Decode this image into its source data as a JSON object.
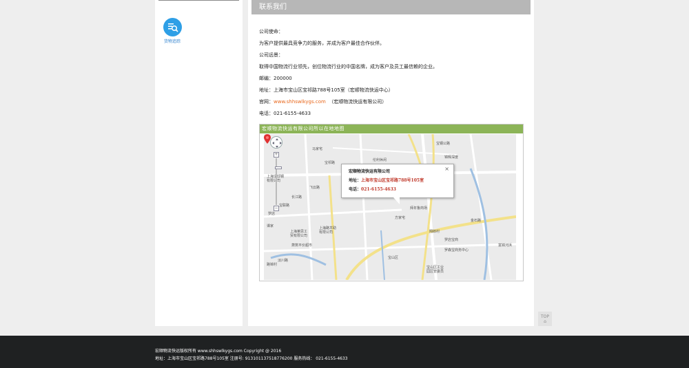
{
  "sidebar": {
    "track_label": "货物追踪",
    "track_icon": "search-list-icon"
  },
  "contact": {
    "header": "联系我们",
    "mission_label": "公司使命：",
    "mission_text": "为客户提供最具竞争力的服务，并成为客户最佳合作伙伴。",
    "vision_label": "公司远景：",
    "vision_text": "取得中国物流行业领先，创位物流行业的中国名牌，成为客户及员工最信赖的企业。",
    "postcode": "邮编：200000",
    "address": "地址：上海市宝山区宝祁路788号105室（宏顺物流快运中心）",
    "website_label": "官网：",
    "website_url": "www.shhswlkygs.com",
    "website_note": "（宏顺物流快运有限公司）",
    "phone": "电话：021-6155-4633"
  },
  "map": {
    "title": "宏顺物流快运有限公司所以在地地图",
    "popup_title": "宏顺物流快运有限公司",
    "popup_address_label": "地址：",
    "popup_address": "上海市宝山区宝祁路788号105室",
    "popup_phone_label": "电话：",
    "popup_phone": "021-6155-4633",
    "labels": [
      "马家宅",
      "宝祁路",
      "宏顺物流快运",
      "伦利休闲",
      "宝钢公路",
      "锦辉深度",
      "金石路",
      "罗店宝商",
      "罗森宝商务中心",
      "富锦河浜",
      "上海宝邸钢",
      "有限公司",
      "宝联路",
      "上海莱思工",
      "贸有限公司",
      "上海路羊助",
      "有限公司",
      "萧筑平价超市",
      "淡川路",
      "谭家",
      "宝山区",
      "宝山区工业",
      "园区管委员",
      "方家宅",
      "拜年鲁商场",
      "翔郎村",
      "路锦村",
      "罗店",
      "长江路",
      "飞云路"
    ],
    "zoom_in": "+",
    "zoom_out": "−",
    "close": "×"
  },
  "top_button": "TOP",
  "footer": {
    "line1": "宏顺物流快运版权所有 www.shhswlkygs.com Copyright @ 2016",
    "line2": "地址：上海市宝山区宝祁路788号105室 注册号: 913101137518776200 服务热线： 021-6155-4633"
  },
  "colors": {
    "header_bg": "#b7b7b7",
    "map_title_bg": "#8cb457",
    "footer_bg": "#1f2122",
    "link": "#e8671b",
    "track_icon": "#2e9fe6"
  }
}
